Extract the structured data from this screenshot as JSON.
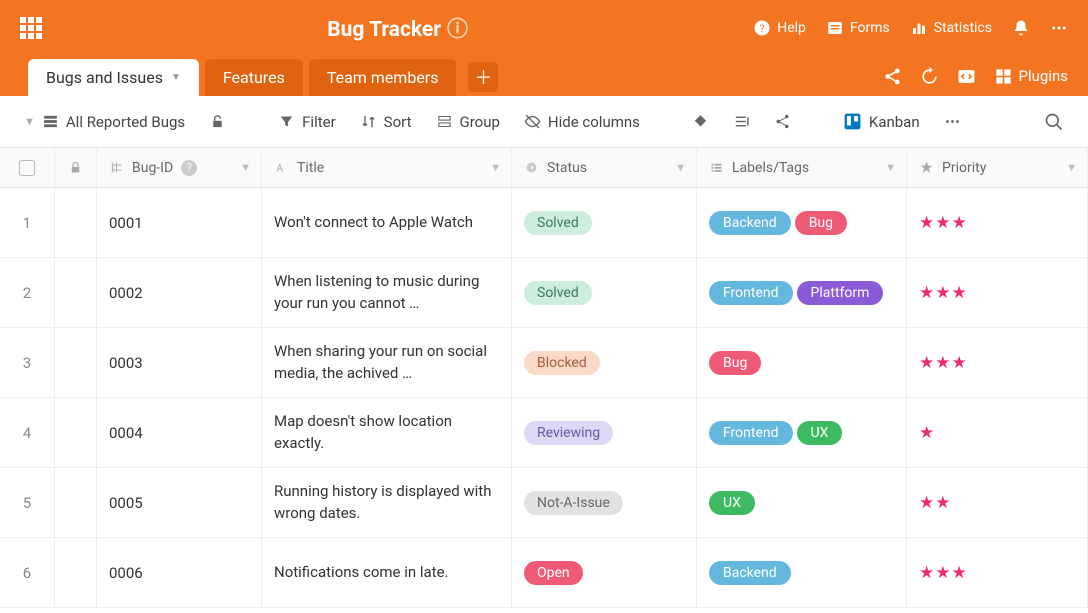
{
  "header": {
    "title": "Bug Tracker",
    "help": "Help",
    "forms": "Forms",
    "statistics": "Statistics"
  },
  "tabs": [
    {
      "label": "Bugs and Issues",
      "active": true
    },
    {
      "label": "Features",
      "active": false
    },
    {
      "label": "Team members",
      "active": false
    }
  ],
  "plugins_label": "Plugins",
  "toolbar": {
    "view": "All Reported Bugs",
    "filter": "Filter",
    "sort": "Sort",
    "group": "Group",
    "hide": "Hide columns",
    "kanban": "Kanban"
  },
  "columns": {
    "id": "Bug-ID",
    "title": "Title",
    "status": "Status",
    "labels": "Labels/Tags",
    "priority": "Priority"
  },
  "rows": [
    {
      "n": "1",
      "id": "0001",
      "title": "Won't connect to Apple Watch",
      "status": "Solved",
      "status_cls": "solved",
      "tags": [
        {
          "t": "Backend",
          "c": "backend"
        },
        {
          "t": "Bug",
          "c": "bug"
        }
      ],
      "stars": 3
    },
    {
      "n": "2",
      "id": "0002",
      "title": "When listening to music during your run you cannot …",
      "status": "Solved",
      "status_cls": "solved",
      "tags": [
        {
          "t": "Frontend",
          "c": "frontend"
        },
        {
          "t": "Plattform",
          "c": "plattform"
        }
      ],
      "stars": 3
    },
    {
      "n": "3",
      "id": "0003",
      "title": "When sharing your run on social media, the achived …",
      "status": "Blocked",
      "status_cls": "blocked",
      "tags": [
        {
          "t": "Bug",
          "c": "bug"
        }
      ],
      "stars": 3
    },
    {
      "n": "4",
      "id": "0004",
      "title": "Map doesn't show location exactly.",
      "status": "Reviewing",
      "status_cls": "reviewing",
      "tags": [
        {
          "t": "Frontend",
          "c": "frontend"
        },
        {
          "t": "UX",
          "c": "ux"
        }
      ],
      "stars": 1
    },
    {
      "n": "5",
      "id": "0005",
      "title": "Running history is displayed with wrong dates.",
      "status": "Not-A-Issue",
      "status_cls": "notissue",
      "tags": [
        {
          "t": "UX",
          "c": "ux"
        }
      ],
      "stars": 2
    },
    {
      "n": "6",
      "id": "0006",
      "title": "Notifications come in late.",
      "status": "Open",
      "status_cls": "open",
      "tags": [
        {
          "t": "Backend",
          "c": "backend"
        }
      ],
      "stars": 3
    }
  ]
}
